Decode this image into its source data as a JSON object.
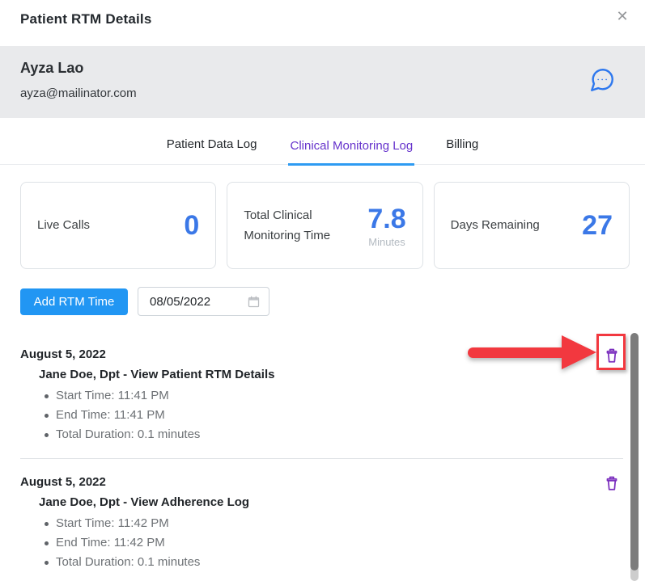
{
  "modal": {
    "title": "Patient RTM Details",
    "close_glyph": "✕"
  },
  "patient": {
    "name": "Ayza Lao",
    "email": "ayza@mailinator.com"
  },
  "tabs": {
    "items": [
      {
        "label": "Patient Data Log"
      },
      {
        "label": "Clinical Monitoring Log"
      },
      {
        "label": "Billing"
      }
    ],
    "active": "Clinical Monitoring Log"
  },
  "stats": {
    "live_calls": {
      "label": "Live Calls",
      "value": "0"
    },
    "monitoring_time": {
      "label": "Total Clinical Monitoring Time",
      "value": "7.8",
      "unit": "Minutes"
    },
    "days_remaining": {
      "label": "Days Remaining",
      "value": "27"
    }
  },
  "actions": {
    "add_rtm_label": "Add RTM Time",
    "date_value": "08/05/2022"
  },
  "log": {
    "entries": [
      {
        "date": "August 5, 2022",
        "title": "Jane Doe, Dpt - View Patient RTM Details",
        "details": [
          "Start Time: 11:41 PM",
          "End Time: 11:41 PM",
          "Total Duration: 0.1 minutes"
        ]
      },
      {
        "date": "August 5, 2022",
        "title": "Jane Doe, Dpt - View Adherence Log",
        "details": [
          "Start Time: 11:42 PM",
          "End Time: 11:42 PM",
          "Total Duration: 0.1 minutes"
        ]
      }
    ]
  },
  "annotation": {
    "description": "red arrow and red box highlighting the delete button of the first log entry"
  },
  "colors": {
    "accent-blue": "#2196f3",
    "stat-blue": "#3b78e7",
    "active-tab-purple": "#6633cc",
    "tab-underline-blue": "#2e9bf2",
    "trash-purple": "#7b2fbe",
    "chat-blue": "#2e78ee",
    "annotation-red": "#f2383f",
    "banner-gray": "#e9eaec"
  }
}
